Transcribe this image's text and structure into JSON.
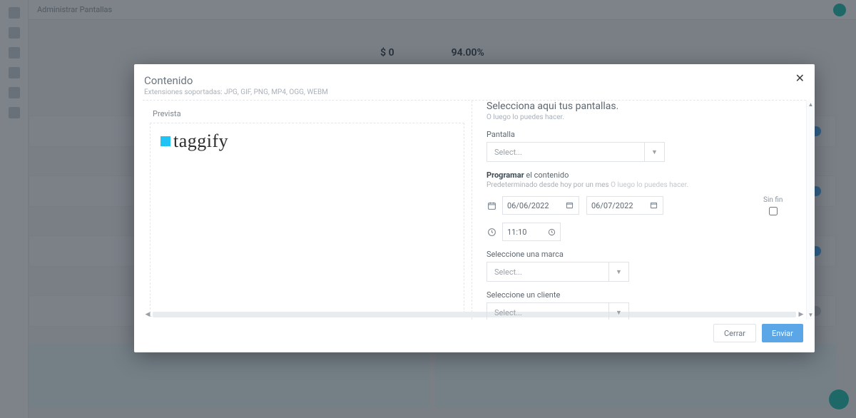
{
  "page": {
    "breadcrumb": "Administrar Pantallas",
    "metrics": {
      "left": "$ 0",
      "right": "94.00%"
    }
  },
  "modal": {
    "title": "Contenido",
    "subtitle": "Extensiones soportadas: JPG, GIF, PNG, MP4, OGG, WEBM",
    "preview_label": "Prevista",
    "logo_text": "taggify",
    "section_title": "Selecciona aqui tus pantallas.",
    "section_sub": "O luego lo puedes hacer.",
    "pantalla_label": "Pantalla",
    "pantalla_placeholder": "Select...",
    "programar_strong": "Programar",
    "programar_rest": " el contenido",
    "programar_sub_left": "Predeterminado desde hoy por un mes ",
    "programar_sub_right": "O luego lo puedes hacer.",
    "date_from": "06/06/2022",
    "date_to": "06/07/2022",
    "sinfin_label": "Sin fin",
    "time": "11:10",
    "marca_label": "Seleccione una marca",
    "marca_placeholder": "Select...",
    "cliente_label": "Seleccione un cliente",
    "cliente_placeholder": "Select...",
    "btn_close": "Cerrar",
    "btn_submit": "Enviar"
  }
}
